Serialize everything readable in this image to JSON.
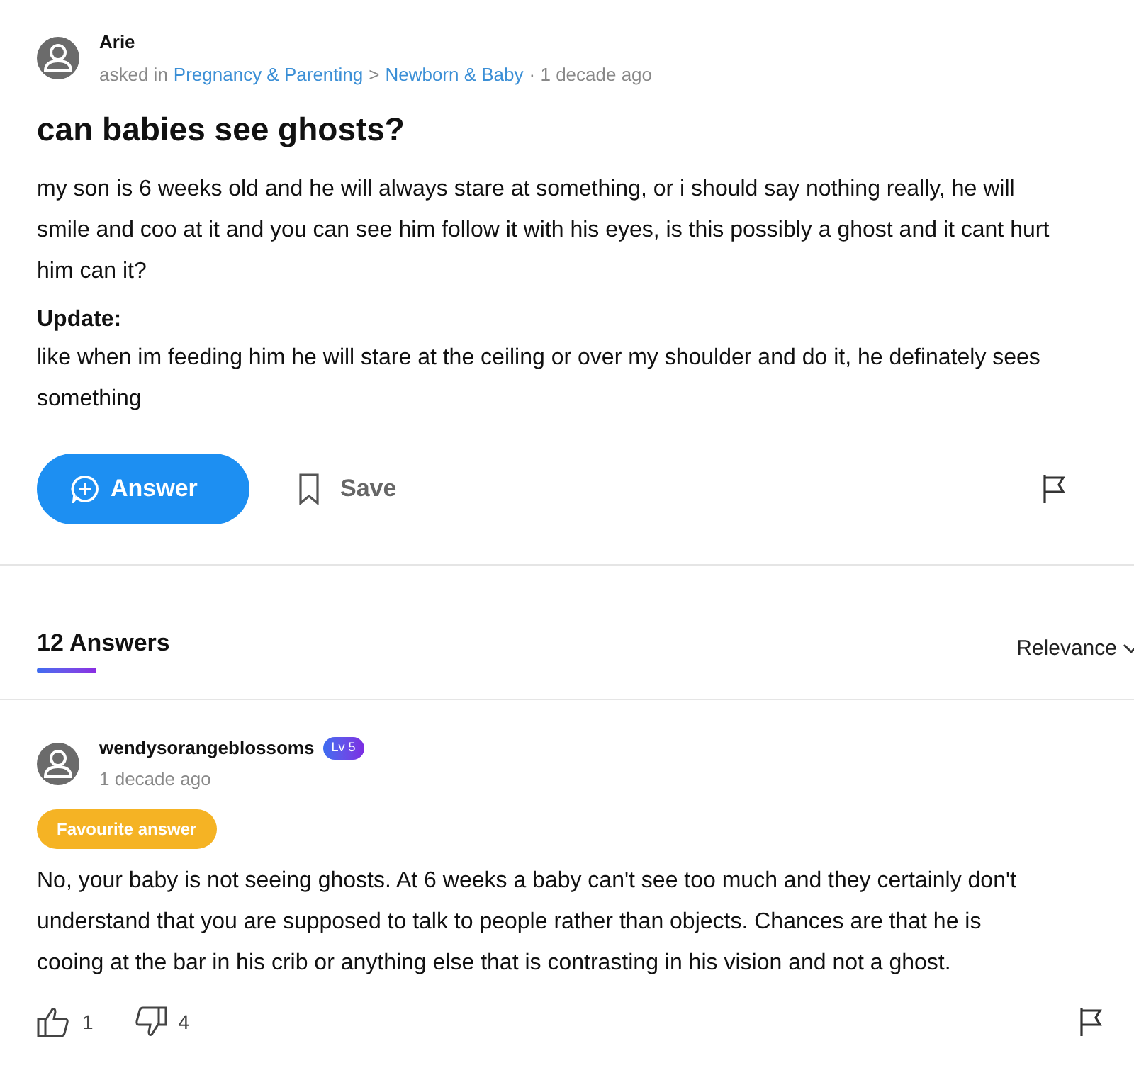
{
  "question": {
    "author": "Arie",
    "asked_in": "asked in",
    "category": "Pregnancy & Parenting",
    "separator": ">",
    "subcategory": "Newborn & Baby",
    "time": "· 1 decade ago",
    "title": "can babies see ghosts?",
    "body": "my son is 6 weeks old and he will always stare at something, or i should say nothing really, he will smile and coo at it and you can see him follow it with his eyes, is this possibly a ghost and it cant hurt him can it?",
    "update_label": "Update:",
    "update": "like when im feeding him he will stare at the ceiling or over my shoulder and do it, he definately sees something"
  },
  "actions": {
    "answer": "Answer",
    "save": "Save"
  },
  "answers_header": {
    "count": "12 Answers",
    "sort": "Relevance"
  },
  "answers": [
    {
      "author": "wendysorangeblossoms",
      "level": "Lv 5",
      "time": "1 decade ago",
      "badge": "Favourite answer",
      "text": "No, your baby is not seeing ghosts.  At 6 weeks a baby can't see too much and they certainly don't understand that you are supposed to talk to people rather than objects.  Chances are that he is cooing at the bar in his crib or anything else that is contrasting in his vision and not a ghost.",
      "likes": "1",
      "dislikes": "4"
    }
  ]
}
